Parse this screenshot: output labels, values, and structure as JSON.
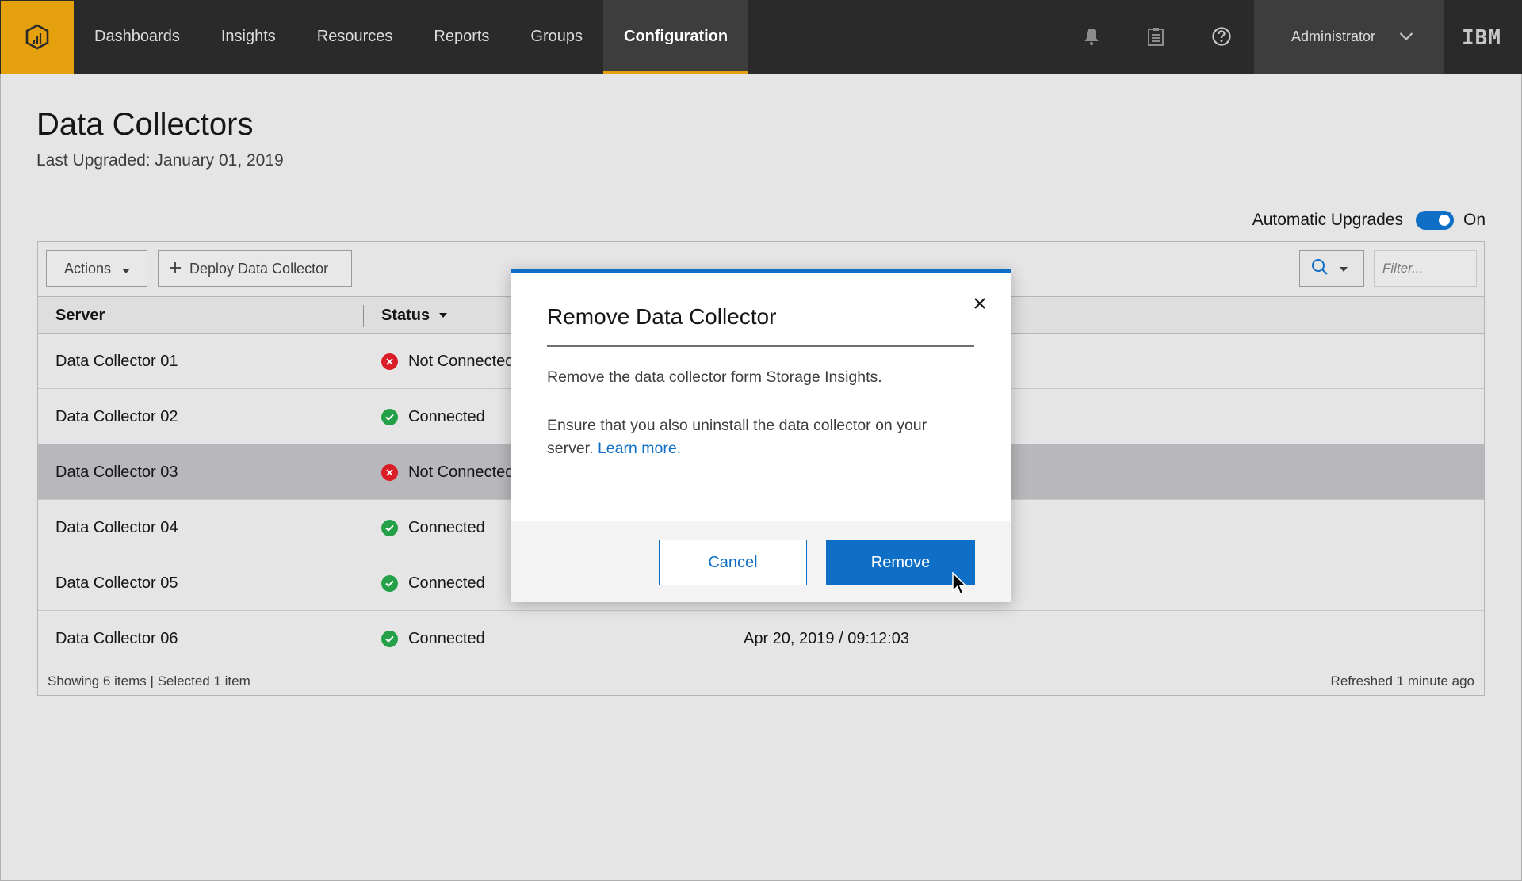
{
  "nav": {
    "logo_icon": "storage-insights-logo-icon",
    "items": [
      {
        "label": "Dashboards",
        "active": false
      },
      {
        "label": "Insights",
        "active": false
      },
      {
        "label": "Resources",
        "active": false
      },
      {
        "label": "Reports",
        "active": false
      },
      {
        "label": "Groups",
        "active": false
      },
      {
        "label": "Configuration",
        "active": true
      }
    ],
    "icons": [
      "bell-icon",
      "clipboard-icon",
      "help-icon"
    ],
    "user": "Administrator",
    "brand": "IBM",
    "accent_color": "#e5a00d"
  },
  "page": {
    "title": "Data Collectors",
    "subtitle": "Last Upgraded: January 01, 2019",
    "auto_upgrades_label": "Automatic Upgrades",
    "auto_upgrades_state": "On"
  },
  "toolbar": {
    "actions_label": "Actions",
    "deploy_label": "Deploy Data Collector",
    "filter_placeholder": "Filter..."
  },
  "table": {
    "columns": [
      "Server",
      "Status"
    ],
    "rows": [
      {
        "server": "Data Collector 01",
        "status": "Not Connected",
        "status_kind": "error",
        "selected": false,
        "date": ""
      },
      {
        "server": "Data Collector 02",
        "status": "Connected",
        "status_kind": "ok",
        "selected": false,
        "date": ""
      },
      {
        "server": "Data Collector 03",
        "status": "Not Connected",
        "status_kind": "error",
        "selected": true,
        "date": ""
      },
      {
        "server": "Data Collector 04",
        "status": "Connected",
        "status_kind": "ok",
        "selected": false,
        "date": ""
      },
      {
        "server": "Data Collector 05",
        "status": "Connected",
        "status_kind": "ok",
        "selected": false,
        "date": ""
      },
      {
        "server": "Data Collector 06",
        "status": "Connected",
        "status_kind": "ok",
        "selected": false,
        "date": "Apr 20, 2019 / 09:12:03"
      }
    ],
    "footer_left": "Showing 6 items | Selected 1 item",
    "footer_right": "Refreshed 1 minute ago"
  },
  "modal": {
    "title": "Remove Data Collector",
    "body1": "Remove the data collector form Storage Insights.",
    "body2": "Ensure that you also uninstall the data collector on your server.",
    "link": "Learn more.",
    "cancel_label": "Cancel",
    "remove_label": "Remove",
    "primary_color": "#0f6fc6"
  }
}
